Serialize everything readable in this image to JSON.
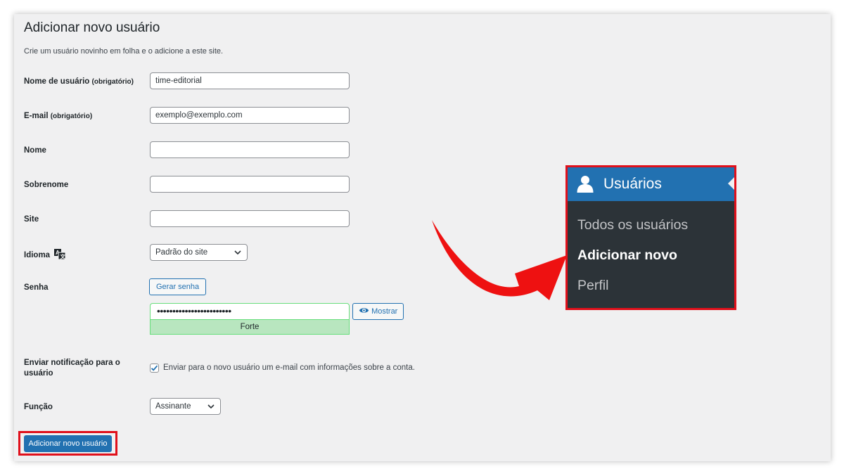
{
  "page": {
    "title": "Adicionar novo usuário",
    "description": "Crie um usuário novinho em folha e o adicione a este site."
  },
  "form": {
    "username": {
      "label": "Nome de usuário",
      "required": "(obrigatório)",
      "value": "time-editorial"
    },
    "email": {
      "label": "E-mail",
      "required": "(obrigatório)",
      "value": "exemplo@exemplo.com"
    },
    "first_name": {
      "label": "Nome",
      "value": ""
    },
    "last_name": {
      "label": "Sobrenome",
      "value": ""
    },
    "site": {
      "label": "Site",
      "value": ""
    },
    "language": {
      "label": "Idioma",
      "value": "Padrão do site"
    },
    "password": {
      "label": "Senha",
      "generate_label": "Gerar senha",
      "value": "••••••••••••••••••••••••",
      "show_label": "Mostrar",
      "strength": "Forte"
    },
    "notify": {
      "label": "Enviar notificação para o usuário",
      "checkbox_text": "Enviar para o novo usuário um e-mail com informações sobre a conta.",
      "checked": true
    },
    "role": {
      "label": "Função",
      "value": "Assinante"
    },
    "submit_label": "Adicionar novo usuário"
  },
  "menu": {
    "title": "Usuários",
    "icon": "user-icon",
    "items": [
      {
        "label": "Todos os usuários",
        "active": false
      },
      {
        "label": "Adicionar novo",
        "active": true
      },
      {
        "label": "Perfil",
        "active": false
      }
    ]
  },
  "colors": {
    "accent": "#2271b1",
    "highlight_border": "#e0101b",
    "arrow": "#ee1111",
    "menu_bg": "#2c3338",
    "strength_bg": "#b8e6bf"
  }
}
